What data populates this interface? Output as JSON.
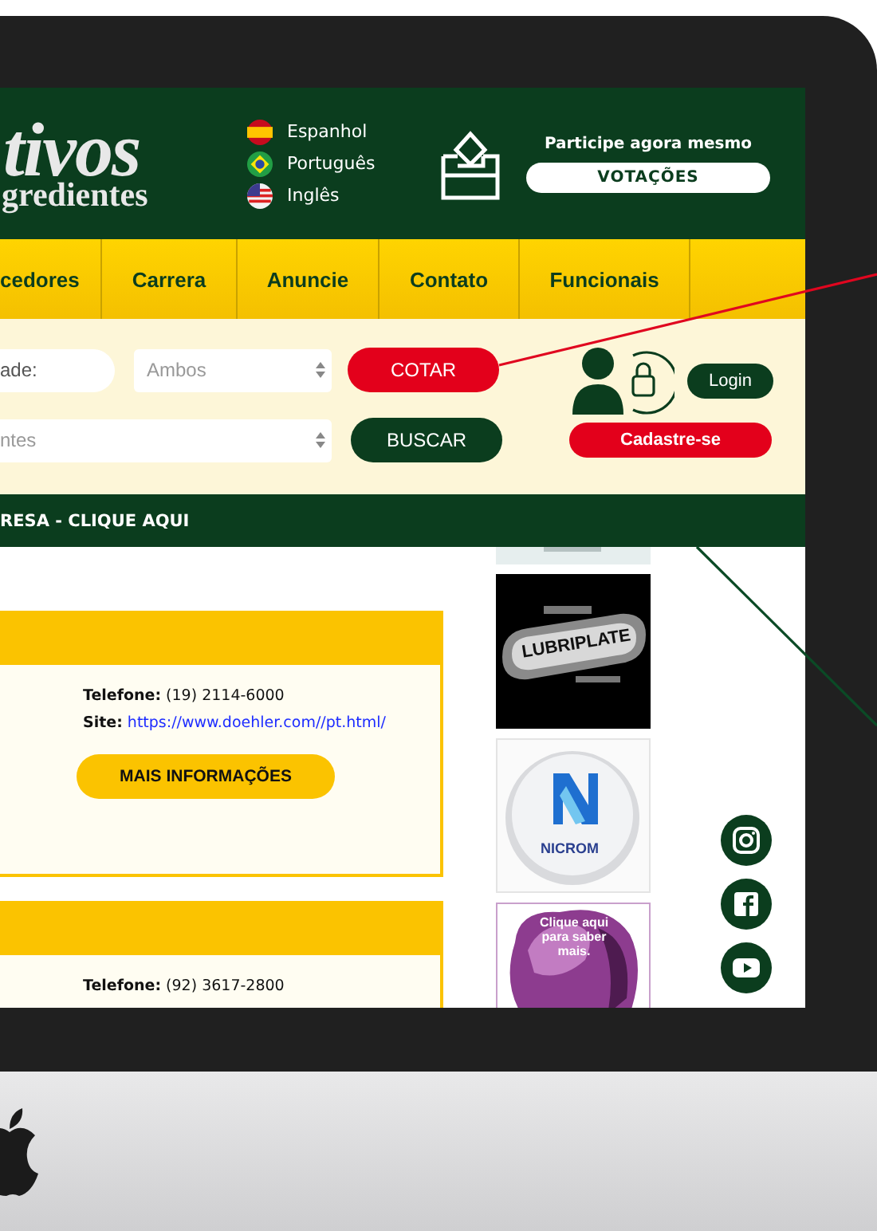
{
  "header": {
    "logo": {
      "line_1": "tivos",
      "line_2": "gredientes"
    },
    "languages": [
      {
        "label": "Espanhol",
        "kind": "spain"
      },
      {
        "label": "Português",
        "kind": "brazil"
      },
      {
        "label": "Inglês",
        "kind": "usa"
      }
    ],
    "vote": {
      "prompt": "Participe agora mesmo",
      "button": "VOTAÇÕES"
    }
  },
  "nav": {
    "items": [
      "cedores",
      "Carrera",
      "Anuncie",
      "Contato",
      "Funcionais"
    ]
  },
  "search": {
    "field": {
      "placeholder": "ade:"
    },
    "select_1": {
      "value": "Ambos"
    },
    "quote_button": "COTAR",
    "select_2": {
      "value": "ntes"
    },
    "search_button": "BUSCAR"
  },
  "account": {
    "login_button": "Login",
    "register_button": "Cadastre-se"
  },
  "banner": "RESA - CLIQUE AQUI",
  "listings": [
    {
      "phone_label": "Telefone:",
      "phone": "(19) 2114-6000",
      "site_label": "Site:",
      "site": "https://www.doehler.com//pt.html/",
      "button": "MAIS INFORMAÇÕES"
    },
    {
      "phone_label": "Telefone:",
      "phone": "(92) 3617-2800"
    }
  ],
  "ads": [
    {
      "kind": "partial"
    },
    {
      "kind": "plate",
      "text": "LUBRIPLATE"
    },
    {
      "kind": "circle",
      "text": "NICROM"
    },
    {
      "kind": "blob",
      "text": "Clique aqui para saber mais."
    }
  ],
  "social": [
    {
      "kind": "instagram"
    },
    {
      "kind": "facebook"
    },
    {
      "kind": "youtube"
    }
  ]
}
